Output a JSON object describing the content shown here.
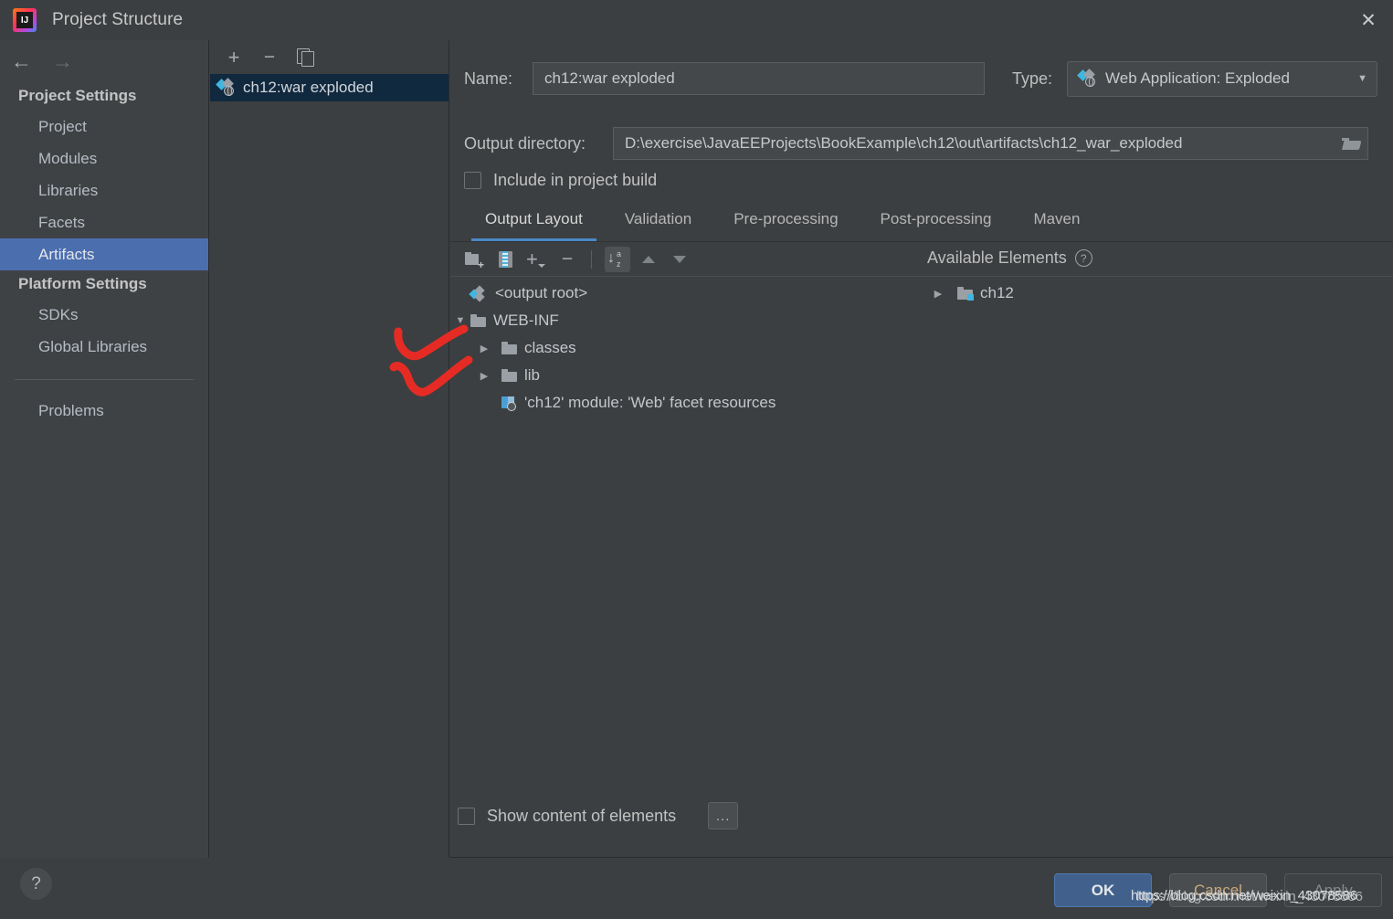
{
  "window": {
    "title": "Project Structure",
    "app_icon": "intellij-idea-logo",
    "close_icon": "close-icon"
  },
  "sidebar": {
    "back_icon": "arrow-left-icon",
    "forward_icon": "arrow-right-icon",
    "groups": [
      {
        "header": "Project Settings",
        "items": [
          {
            "label": "Project",
            "selected": false
          },
          {
            "label": "Modules",
            "selected": false
          },
          {
            "label": "Libraries",
            "selected": false
          },
          {
            "label": "Facets",
            "selected": false
          },
          {
            "label": "Artifacts",
            "selected": true
          }
        ]
      },
      {
        "header": "Platform Settings",
        "items": [
          {
            "label": "SDKs",
            "selected": false
          },
          {
            "label": "Global Libraries",
            "selected": false
          }
        ]
      }
    ],
    "problems": {
      "label": "Problems"
    }
  },
  "artifact_panel": {
    "toolbar": [
      {
        "name": "add-artifact-button",
        "icon": "plus-icon"
      },
      {
        "name": "remove-artifact-button",
        "icon": "minus-icon"
      },
      {
        "name": "copy-artifact-button",
        "icon": "copy-icon"
      }
    ],
    "items": [
      {
        "label": "ch12:war exploded",
        "icon": "artifact-icon",
        "selected": true
      }
    ]
  },
  "detail": {
    "name_label": "Name:",
    "name_value": "ch12:war exploded",
    "type_label": "Type:",
    "type_value": "Web Application: Exploded",
    "type_icon": "artifact-icon",
    "type_caret_icon": "chevron-down-icon",
    "output_dir_label": "Output directory:",
    "output_dir_value": "D:\\exercise\\JavaEEProjects\\BookExample\\ch12\\out\\artifacts\\ch12_war_exploded",
    "browse_icon": "folder-open-icon",
    "include_in_build_label": "Include in project build",
    "include_in_build_checked": false,
    "tabs": [
      {
        "label": "Output Layout",
        "active": true
      },
      {
        "label": "Validation",
        "active": false
      },
      {
        "label": "Pre-processing",
        "active": false
      },
      {
        "label": "Post-processing",
        "active": false
      },
      {
        "label": "Maven",
        "active": false
      }
    ],
    "layout_toolbar": [
      {
        "name": "create-directory-button",
        "icon": "new-folder-icon"
      },
      {
        "name": "create-archive-button",
        "icon": "archive-icon"
      },
      {
        "name": "add-copy-of-button",
        "icon": "plus-dropdown-icon"
      },
      {
        "name": "remove-element-button",
        "icon": "minus-icon"
      },
      {
        "name": "sort-elements-button",
        "icon": "sort-az-icon"
      },
      {
        "name": "move-up-button",
        "icon": "arrow-up-icon"
      },
      {
        "name": "move-down-button",
        "icon": "arrow-down-icon"
      }
    ],
    "available_elements_title": "Available Elements",
    "available_elements_help_icon": "help-circle-icon",
    "output_tree": [
      {
        "label": "<output root>",
        "icon": "output-root-icon",
        "twist": "",
        "indent": 0
      },
      {
        "label": "WEB-INF",
        "icon": "folder-icon",
        "twist": "expanded",
        "indent": 0
      },
      {
        "label": "classes",
        "icon": "folder-icon",
        "twist": "collapsed",
        "indent": 1
      },
      {
        "label": "lib",
        "icon": "folder-icon",
        "twist": "collapsed",
        "indent": 1
      },
      {
        "label": "'ch12' module: 'Web' facet resources",
        "icon": "facet-resources-icon",
        "twist": "",
        "indent": 1
      }
    ],
    "available_tree": [
      {
        "label": "ch12",
        "icon": "module-folder-icon",
        "twist": "collapsed",
        "indent": 0
      }
    ],
    "show_content_label": "Show content of elements",
    "show_content_checked": false,
    "ellipsis_label": "..."
  },
  "bottom": {
    "help_icon": "question-mark-icon",
    "ok_label": "OK",
    "cancel_label": "Cancel",
    "apply_label": "Apply"
  },
  "watermark": {
    "line1": "https://blog.csdn.net/weixin_43078586",
    "line2": "https://blog.csdn.net/weixin_43078586"
  },
  "annotations": {
    "checkmark_color": "#e62b24",
    "marks": [
      {
        "name": "red-check-classes"
      },
      {
        "name": "red-check-lib"
      }
    ]
  },
  "colors": {
    "window_bg": "#3c3f41",
    "sidebar_bg": "#3f4245",
    "selection_blue": "#4b6eaf",
    "row_selection": "#10293f",
    "tab_underline": "#4a88c7",
    "ok_button": "#41618c",
    "cancel_text": "#c8a87a"
  }
}
